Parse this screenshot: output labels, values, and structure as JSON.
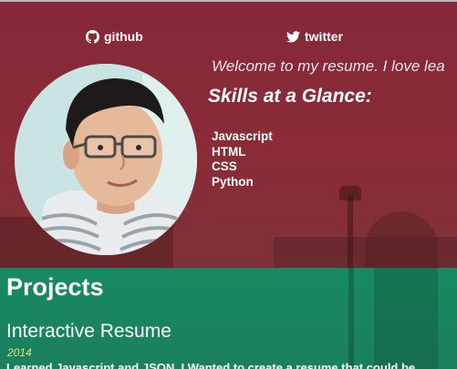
{
  "header": {
    "links": {
      "github": "github",
      "twitter": "twitter"
    },
    "welcome": "Welcome to my resume. I love lea",
    "skills_title": "Skills at a Glance:",
    "skills": [
      "Javascript",
      "HTML",
      "CSS",
      "Python"
    ]
  },
  "projects": {
    "title": "Projects",
    "items": [
      {
        "name": "Interactive Resume",
        "year": "2014",
        "description": "Learned Javascript and JSON. I Wanted to create a resume that could be"
      }
    ]
  },
  "colors": {
    "header_tint": "#85283a",
    "projects_bg": "#188a60",
    "year_text": "#e8e27a"
  },
  "icons": [
    "github-icon",
    "twitter-icon"
  ]
}
